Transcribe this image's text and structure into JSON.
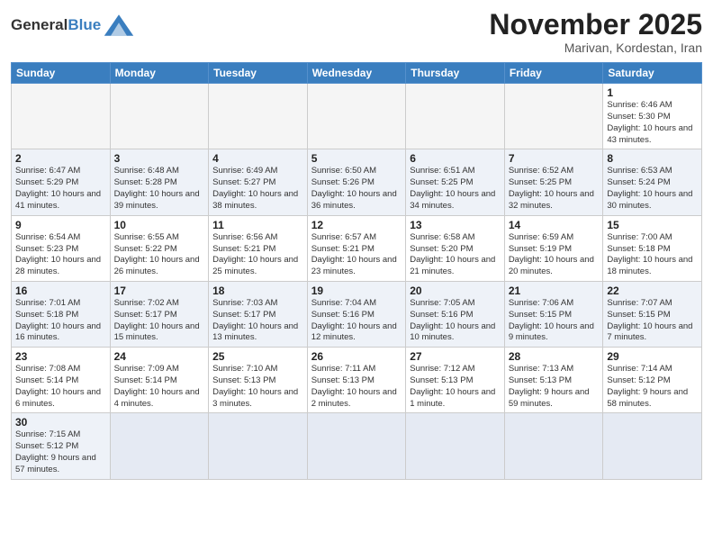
{
  "header": {
    "logo_general": "General",
    "logo_blue": "Blue",
    "month_title": "November 2025",
    "subtitle": "Marivan, Kordestan, Iran"
  },
  "weekdays": [
    "Sunday",
    "Monday",
    "Tuesday",
    "Wednesday",
    "Thursday",
    "Friday",
    "Saturday"
  ],
  "days": {
    "1": {
      "sunrise": "6:46 AM",
      "sunset": "5:30 PM",
      "daylight": "10 hours and 43 minutes."
    },
    "2": {
      "sunrise": "6:47 AM",
      "sunset": "5:29 PM",
      "daylight": "10 hours and 41 minutes."
    },
    "3": {
      "sunrise": "6:48 AM",
      "sunset": "5:28 PM",
      "daylight": "10 hours and 39 minutes."
    },
    "4": {
      "sunrise": "6:49 AM",
      "sunset": "5:27 PM",
      "daylight": "10 hours and 38 minutes."
    },
    "5": {
      "sunrise": "6:50 AM",
      "sunset": "5:26 PM",
      "daylight": "10 hours and 36 minutes."
    },
    "6": {
      "sunrise": "6:51 AM",
      "sunset": "5:25 PM",
      "daylight": "10 hours and 34 minutes."
    },
    "7": {
      "sunrise": "6:52 AM",
      "sunset": "5:25 PM",
      "daylight": "10 hours and 32 minutes."
    },
    "8": {
      "sunrise": "6:53 AM",
      "sunset": "5:24 PM",
      "daylight": "10 hours and 30 minutes."
    },
    "9": {
      "sunrise": "6:54 AM",
      "sunset": "5:23 PM",
      "daylight": "10 hours and 28 minutes."
    },
    "10": {
      "sunrise": "6:55 AM",
      "sunset": "5:22 PM",
      "daylight": "10 hours and 26 minutes."
    },
    "11": {
      "sunrise": "6:56 AM",
      "sunset": "5:21 PM",
      "daylight": "10 hours and 25 minutes."
    },
    "12": {
      "sunrise": "6:57 AM",
      "sunset": "5:21 PM",
      "daylight": "10 hours and 23 minutes."
    },
    "13": {
      "sunrise": "6:58 AM",
      "sunset": "5:20 PM",
      "daylight": "10 hours and 21 minutes."
    },
    "14": {
      "sunrise": "6:59 AM",
      "sunset": "5:19 PM",
      "daylight": "10 hours and 20 minutes."
    },
    "15": {
      "sunrise": "7:00 AM",
      "sunset": "5:18 PM",
      "daylight": "10 hours and 18 minutes."
    },
    "16": {
      "sunrise": "7:01 AM",
      "sunset": "5:18 PM",
      "daylight": "10 hours and 16 minutes."
    },
    "17": {
      "sunrise": "7:02 AM",
      "sunset": "5:17 PM",
      "daylight": "10 hours and 15 minutes."
    },
    "18": {
      "sunrise": "7:03 AM",
      "sunset": "5:17 PM",
      "daylight": "10 hours and 13 minutes."
    },
    "19": {
      "sunrise": "7:04 AM",
      "sunset": "5:16 PM",
      "daylight": "10 hours and 12 minutes."
    },
    "20": {
      "sunrise": "7:05 AM",
      "sunset": "5:16 PM",
      "daylight": "10 hours and 10 minutes."
    },
    "21": {
      "sunrise": "7:06 AM",
      "sunset": "5:15 PM",
      "daylight": "10 hours and 9 minutes."
    },
    "22": {
      "sunrise": "7:07 AM",
      "sunset": "5:15 PM",
      "daylight": "10 hours and 7 minutes."
    },
    "23": {
      "sunrise": "7:08 AM",
      "sunset": "5:14 PM",
      "daylight": "10 hours and 6 minutes."
    },
    "24": {
      "sunrise": "7:09 AM",
      "sunset": "5:14 PM",
      "daylight": "10 hours and 4 minutes."
    },
    "25": {
      "sunrise": "7:10 AM",
      "sunset": "5:13 PM",
      "daylight": "10 hours and 3 minutes."
    },
    "26": {
      "sunrise": "7:11 AM",
      "sunset": "5:13 PM",
      "daylight": "10 hours and 2 minutes."
    },
    "27": {
      "sunrise": "7:12 AM",
      "sunset": "5:13 PM",
      "daylight": "10 hours and 1 minute."
    },
    "28": {
      "sunrise": "7:13 AM",
      "sunset": "5:13 PM",
      "daylight": "9 hours and 59 minutes."
    },
    "29": {
      "sunrise": "7:14 AM",
      "sunset": "5:12 PM",
      "daylight": "9 hours and 58 minutes."
    },
    "30": {
      "sunrise": "7:15 AM",
      "sunset": "5:12 PM",
      "daylight": "9 hours and 57 minutes."
    }
  },
  "labels": {
    "sunrise": "Sunrise:",
    "sunset": "Sunset:",
    "daylight": "Daylight:"
  }
}
